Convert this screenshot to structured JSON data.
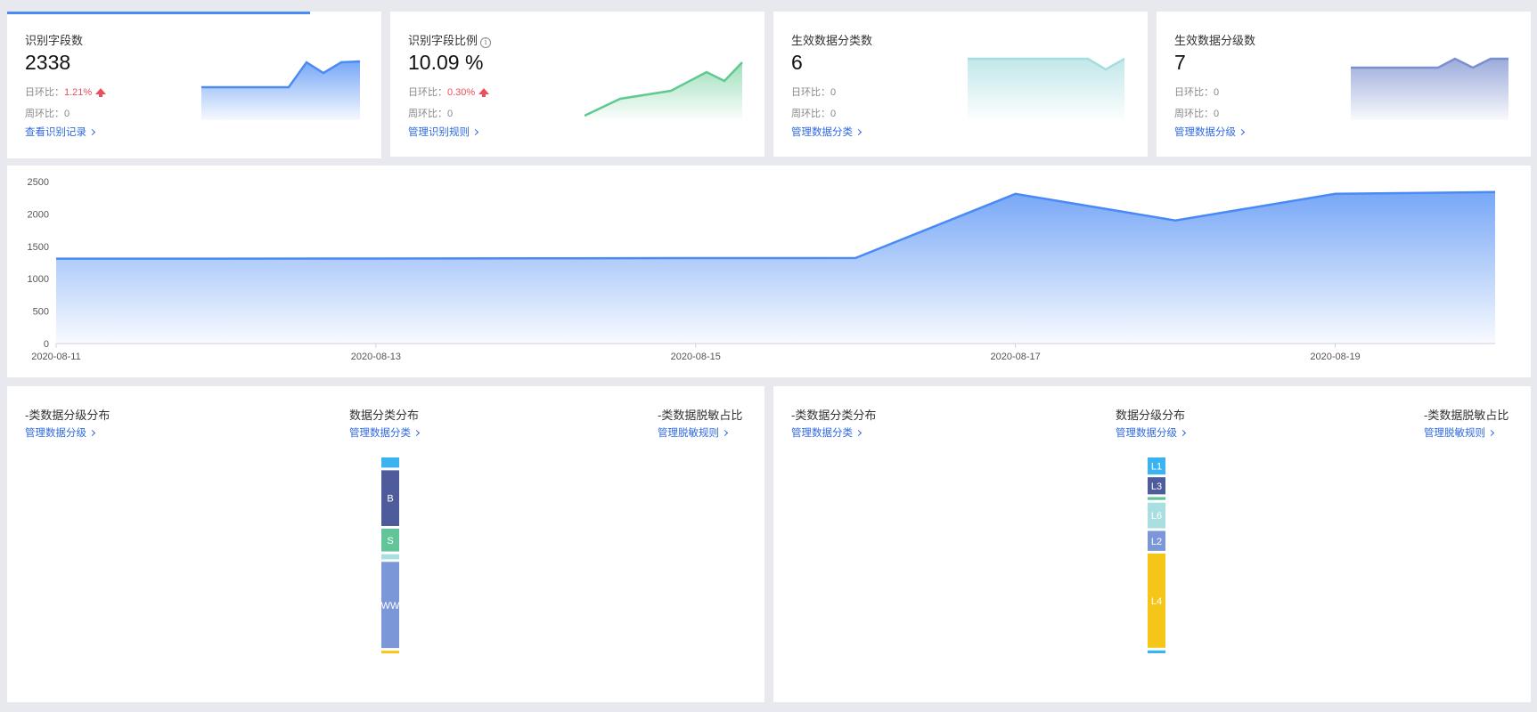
{
  "kpis": [
    {
      "title": "识别字段数",
      "value": "2338",
      "day_label": "日环比：",
      "day_value": "1.21%",
      "day_up": true,
      "week_label": "周环比：",
      "week_value": "0",
      "link": "查看识别记录"
    },
    {
      "title": "识别字段比例",
      "value": "10.09 %",
      "day_label": "日环比：",
      "day_value": "0.30%",
      "day_up": true,
      "week_label": "周环比：",
      "week_value": "0",
      "link": "管理识别规则"
    },
    {
      "title": "生效数据分类数",
      "value": "6",
      "day_label": "日环比：",
      "day_value": "0",
      "week_label": "周环比：",
      "week_value": "0",
      "link": "管理数据分类"
    },
    {
      "title": "生效数据分级数",
      "value": "7",
      "day_label": "日环比：",
      "day_value": "0",
      "week_label": "周环比：",
      "week_value": "0",
      "link": "管理数据分级"
    }
  ],
  "colors": {
    "blue": "#4a8af4",
    "green": "#5fc98f",
    "teal": "#a8dde0",
    "navy": "#7a8fcf",
    "link": "#2f6ae0",
    "red": "#e8505b"
  },
  "chart_data": {
    "type": "area",
    "x": [
      "2020-08-11",
      "2020-08-12",
      "2020-08-13",
      "2020-08-14",
      "2020-08-15",
      "2020-08-16",
      "2020-08-17",
      "2020-08-18",
      "2020-08-19",
      "2020-08-20"
    ],
    "x_tick_labels": [
      "2020-08-11",
      "2020-08-13",
      "2020-08-15",
      "2020-08-17",
      "2020-08-19"
    ],
    "values": [
      1310,
      1310,
      1312,
      1315,
      1318,
      1320,
      2310,
      1900,
      2310,
      2338
    ],
    "yticks": [
      0,
      500,
      1000,
      1500,
      2000,
      2500
    ],
    "ylim": [
      0,
      2500
    ],
    "color": "#4a8af4"
  },
  "left_panel": {
    "sections": [
      {
        "title": "-类数据分级分布",
        "link": "管理数据分级"
      },
      {
        "title": "数据分类分布",
        "link": "管理数据分类"
      },
      {
        "title": "-类数据脱敏占比",
        "link": "管理脱敏规则"
      }
    ],
    "stack": [
      {
        "label": "",
        "value": 4,
        "color": "#3ab3f0"
      },
      {
        "label": "B",
        "value": 22,
        "color": "#4e5c9c"
      },
      {
        "label": "S",
        "value": 9,
        "color": "#62c59a"
      },
      {
        "label": "",
        "value": 2,
        "color": "#a9dfe0"
      },
      {
        "label": "WW",
        "value": 34,
        "color": "#7b97d8"
      },
      {
        "label": "",
        "value": 1,
        "color": "#f5c518"
      }
    ]
  },
  "right_panel": {
    "sections": [
      {
        "title": "-类数据分类分布",
        "link": "管理数据分类"
      },
      {
        "title": "数据分级分布",
        "link": "管理数据分级"
      },
      {
        "title": "-类数据脱敏占比",
        "link": "管理脱敏规则"
      }
    ],
    "stack": [
      {
        "label": "L1",
        "value": 6,
        "color": "#3ab3f0"
      },
      {
        "label": "L3",
        "value": 6,
        "color": "#4e5c9c"
      },
      {
        "label": "",
        "value": 1,
        "color": "#62c59a"
      },
      {
        "label": "L6",
        "value": 9,
        "color": "#a9dfe0"
      },
      {
        "label": "L2",
        "value": 7,
        "color": "#7b97d8"
      },
      {
        "label": "L4",
        "value": 33,
        "color": "#f5c518"
      },
      {
        "label": "",
        "value": 1,
        "color": "#3ab3f0"
      }
    ]
  }
}
